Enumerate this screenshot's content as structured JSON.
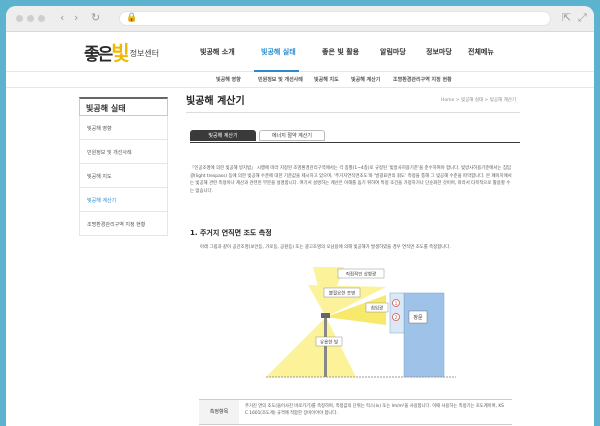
{
  "header": {
    "logo_big_1": "좋은",
    "logo_accent": "빛",
    "logo_small": "정보센터",
    "gnb": [
      "빛공해 소개",
      "빛공해 실태",
      "좋은 빛 활용",
      "알림마당",
      "정보마당",
      "전체메뉴"
    ]
  },
  "subnav": [
    "빛공해 영향",
    "민원정보 및 개선사례",
    "빛공해 지도",
    "빛공해 계산기",
    "조명환경관리구역 지정 현황"
  ],
  "sidebar": {
    "title": "빛공해 실태",
    "items": [
      "빛공해 영향",
      "민원정보 및 개선사례",
      "빛공해 지도",
      "빛공해 계산기",
      "조명환경관리구역 지정 현황"
    ]
  },
  "main": {
    "title": "빛공해 계산기",
    "breadcrumb": "Home > 빛공해 실태 > 빛공해 계산기",
    "tabs": [
      "빛공해 계산기",
      "에너지 절약 계산기"
    ],
    "intro": "『인공조명에 의한 빛공해 방지법』 시행에 따라 지정된 조명환경관리구역에서는 각 종별(1~4종)로 규정된 '빛방사허용기준'을 준수하여야 합니다. 빛방사허용기준에서는 침입광(light trespass) 등에 의한 빛공해 수준에 대한 기준값을 제시하고 있으며, '주거지연직면조도'와 '발광표면의 휘도' 측정을 통해 그 빛공해 수준을 파악합니다. 본 페이지에서는 빛공해 관련 측정이나 계산과 관련된 부분을 설명합니다. 여기서 설명하는 계산은 이해를 돕기 위하여 특정 조건을 가정하거나 단순화한 것이며, 따라서 타목적으로 활용할 수는 없습니다.",
    "section_title": "1. 주거지 연직면 조도 측정",
    "section_desc": "아래 그림과 같이 공간조명(보안등, 가로등, 공원등) 또는 광고조명의 오남용에 의해 빛공해가 발생하였을 경우 연직면 조도를 측정합니다.",
    "diagram": {
      "label_top": "직접적인 상향광",
      "label_bad": "불필요한 조명",
      "label_trespass": "침입광",
      "label_useful": "유용한 빛",
      "label_window": "창문",
      "marker_1": "1",
      "marker_2": "2"
    },
    "table": {
      "header": "측정항목",
      "body": "주거진 면의 조도(들어사진 바로가기)를 측정하며, 측정값의 단위는 럭스(lx) 또는 lm/m²을 사용합니다. 이때 사용하는 측정기는 조도계이며, KS C 1601(조도계) 규격에 적합한 장비이어야 합니다."
    }
  },
  "colors": {
    "accent": "#2a8bd1",
    "logo_yellow": "#f2b800",
    "light_yellow": "#fbf29a",
    "building": "#9fc2e8",
    "marker_red": "#d9534f"
  },
  "icons": [
    "chevron-left-icon",
    "chevron-right-icon",
    "reload-icon",
    "lock-icon",
    "share-icon",
    "expand-icon"
  ]
}
